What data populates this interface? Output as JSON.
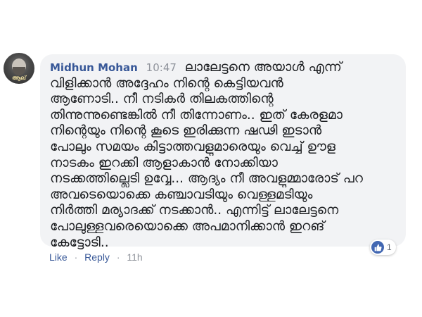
{
  "comment": {
    "author": "Midhun Mohan",
    "time": "10:47",
    "first_line_text": "ലാലേട്ടനെ അയാൾ എന്ന്",
    "lines": [
      "വിളിക്കാൻ അദ്ദേഹം നിന്റെ കെട്ടിയവൻ",
      "ആണോടി.. നീ നടികർ തിലകത്തിന്റെ",
      "തിന്നുന്നുണ്ടെങ്കിൽ നീ തിന്നോണം.. ഇത് കേരളമാ",
      "നിന്റെയും നിന്റെ കൂടെ ഇരിക്കുന്ന ഷഢി ഇടാൻ",
      "പോലും സമയം കിട്ടാത്തവളുമാരെയും വെച്ച് ഊള",
      "നാടകം ഇറക്കി ആളാകാൻ നോക്കിയാ",
      "നടക്കത്തില്ലെടി ഉവ്വേ... ആദ്യം നീ അവളുമ്മാരോട് പറ",
      "അവടെയൊക്കെ കഞ്ചാവടിയും വെള്ളമടിയും",
      "നിർത്തി മര്യാദക്ക് നടക്കാൻ.. എന്നിട്ട് ലാലേട്ടനെ",
      "പോലുള്ളവരെയൊക്കെ അപമാനിക്കാൻ ഇറങ്",
      "കേട്ടോടി.."
    ]
  },
  "actions": {
    "like_label": "Like",
    "separator": "·",
    "reply_label": "Reply",
    "age": "11h"
  },
  "reaction": {
    "icon": "thumbs-up-icon",
    "count": "1",
    "color": "#4267b2"
  },
  "avatar": {
    "tag_text": "ആല്"
  },
  "colors": {
    "author": "#385898",
    "timestamp": "#90949c",
    "bubble": "#f2f3f5"
  }
}
